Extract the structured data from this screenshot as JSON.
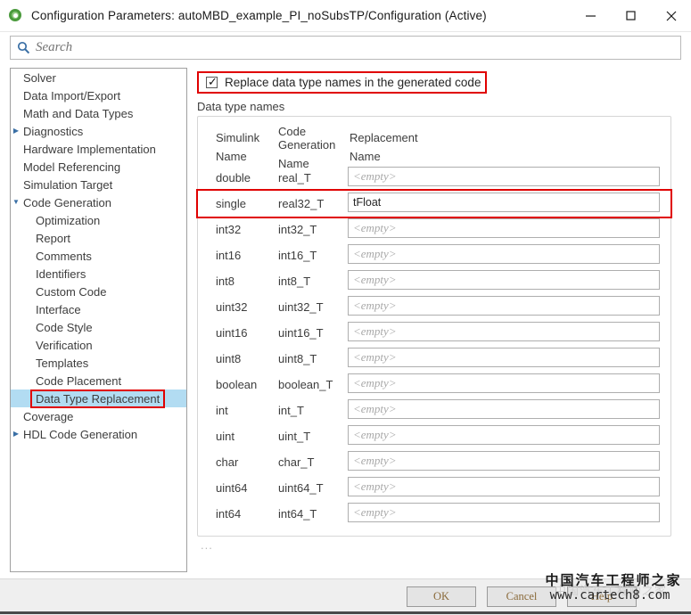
{
  "window": {
    "title": "Configuration Parameters: autoMBD_example_PI_noSubsTP/Configuration (Active)",
    "icon": "simulink-icon",
    "minimize_glyph": "—",
    "maximize_glyph": "□",
    "close_glyph": "✕"
  },
  "search": {
    "placeholder": "Search",
    "value": "",
    "icon": "search-icon"
  },
  "sidebar": {
    "items": [
      {
        "label": "Solver",
        "level": 0,
        "arrow": "",
        "selected": false
      },
      {
        "label": "Data Import/Export",
        "level": 0,
        "arrow": "",
        "selected": false
      },
      {
        "label": "Math and Data Types",
        "level": 0,
        "arrow": "",
        "selected": false
      },
      {
        "label": "Diagnostics",
        "level": 0,
        "arrow": "▶",
        "selected": false
      },
      {
        "label": "Hardware Implementation",
        "level": 0,
        "arrow": "",
        "selected": false
      },
      {
        "label": "Model Referencing",
        "level": 0,
        "arrow": "",
        "selected": false
      },
      {
        "label": "Simulation Target",
        "level": 0,
        "arrow": "",
        "selected": false
      },
      {
        "label": "Code Generation",
        "level": 0,
        "arrow": "▼",
        "selected": false
      },
      {
        "label": "Optimization",
        "level": 1,
        "arrow": "",
        "selected": false
      },
      {
        "label": "Report",
        "level": 1,
        "arrow": "",
        "selected": false
      },
      {
        "label": "Comments",
        "level": 1,
        "arrow": "",
        "selected": false
      },
      {
        "label": "Identifiers",
        "level": 1,
        "arrow": "",
        "selected": false
      },
      {
        "label": "Custom Code",
        "level": 1,
        "arrow": "",
        "selected": false
      },
      {
        "label": "Interface",
        "level": 1,
        "arrow": "",
        "selected": false
      },
      {
        "label": "Code Style",
        "level": 1,
        "arrow": "",
        "selected": false
      },
      {
        "label": "Verification",
        "level": 1,
        "arrow": "",
        "selected": false
      },
      {
        "label": "Templates",
        "level": 1,
        "arrow": "",
        "selected": false
      },
      {
        "label": "Code Placement",
        "level": 1,
        "arrow": "",
        "selected": false
      },
      {
        "label": "Data Type Replacement",
        "level": 1,
        "arrow": "",
        "selected": true,
        "highlighted": true
      },
      {
        "label": "Coverage",
        "level": 0,
        "arrow": "",
        "selected": false
      },
      {
        "label": "HDL Code Generation",
        "level": 0,
        "arrow": "▶",
        "selected": false
      }
    ]
  },
  "main": {
    "checkbox": {
      "label": "Replace data type names in the generated code",
      "checked": true,
      "highlighted": true
    },
    "group_label": "Data type names",
    "table": {
      "headers": [
        {
          "line1": "Simulink",
          "line2": "Name"
        },
        {
          "line1": "Code Generation",
          "line2": "Name"
        },
        {
          "line1": "Replacement",
          "line2": "Name"
        }
      ],
      "empty_placeholder": "<empty>",
      "rows": [
        {
          "simulink": "double",
          "codegen": "real_T",
          "replacement": "",
          "highlighted": false
        },
        {
          "simulink": "single",
          "codegen": "real32_T",
          "replacement": "tFloat",
          "highlighted": true
        },
        {
          "simulink": "int32",
          "codegen": "int32_T",
          "replacement": "",
          "highlighted": false
        },
        {
          "simulink": "int16",
          "codegen": "int16_T",
          "replacement": "",
          "highlighted": false
        },
        {
          "simulink": "int8",
          "codegen": "int8_T",
          "replacement": "",
          "highlighted": false
        },
        {
          "simulink": "uint32",
          "codegen": "uint32_T",
          "replacement": "",
          "highlighted": false
        },
        {
          "simulink": "uint16",
          "codegen": "uint16_T",
          "replacement": "",
          "highlighted": false
        },
        {
          "simulink": "uint8",
          "codegen": "uint8_T",
          "replacement": "",
          "highlighted": false
        },
        {
          "simulink": "boolean",
          "codegen": "boolean_T",
          "replacement": "",
          "highlighted": false
        },
        {
          "simulink": "int",
          "codegen": "int_T",
          "replacement": "",
          "highlighted": false
        },
        {
          "simulink": "uint",
          "codegen": "uint_T",
          "replacement": "",
          "highlighted": false
        },
        {
          "simulink": "char",
          "codegen": "char_T",
          "replacement": "",
          "highlighted": false
        },
        {
          "simulink": "uint64",
          "codegen": "uint64_T",
          "replacement": "",
          "highlighted": false
        },
        {
          "simulink": "int64",
          "codegen": "int64_T",
          "replacement": "",
          "highlighted": false
        }
      ]
    },
    "ellipsis": "..."
  },
  "footer": {
    "buttons": [
      {
        "label": "OK"
      },
      {
        "label": "Cancel"
      },
      {
        "label": "Help"
      }
    ]
  },
  "watermark": {
    "chinese": "中国汽车工程师之家",
    "url": "www.cartech8.com",
    "ghost": "中国汽车工程师之家"
  },
  "colors": {
    "accent_red": "#e00000",
    "selection_blue": "#b2dcf2",
    "search_icon_blue": "#3a6fa5"
  }
}
